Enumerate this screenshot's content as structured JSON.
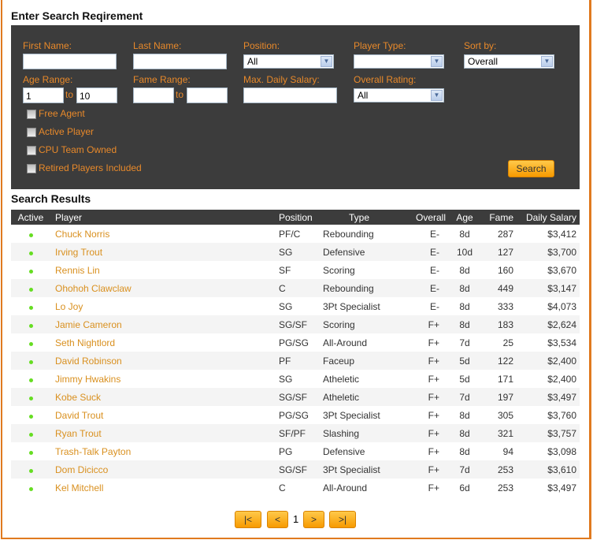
{
  "search": {
    "title": "Enter Search Reqirement",
    "first_name_label": "First Name:",
    "first_name": "",
    "last_name_label": "Last Name:",
    "last_name": "",
    "position_label": "Position:",
    "position": "All",
    "player_type_label": "Player Type:",
    "player_type": "",
    "sort_by_label": "Sort by:",
    "sort_by": "Overall",
    "age_range_label": "Age Range:",
    "age_min": "1",
    "age_max": "10",
    "to": "to",
    "fame_range_label": "Fame Range:",
    "fame_min": "",
    "fame_max": "",
    "max_salary_label": "Max. Daily Salary:",
    "max_salary": "",
    "overall_rating_label": "Overall Rating:",
    "overall_rating": "All",
    "checkboxes": [
      "Free Agent",
      "Active Player",
      "CPU Team Owned",
      "Retired Players Included"
    ],
    "search_button": "Search"
  },
  "results": {
    "title": "Search Results",
    "columns": [
      "Active",
      "Player",
      "Position",
      "Type",
      "Overall",
      "Age",
      "Fame",
      "Daily Salary"
    ],
    "rows": [
      [
        "Chuck Norris",
        "PF/C",
        "Rebounding",
        "E-",
        "8d",
        "287",
        "$3,412"
      ],
      [
        "Irving Trout",
        "SG",
        "Defensive",
        "E-",
        "10d",
        "127",
        "$3,700"
      ],
      [
        "Rennis Lin",
        "SF",
        "Scoring",
        "E-",
        "8d",
        "160",
        "$3,670"
      ],
      [
        "Ohohoh Clawclaw",
        "C",
        "Rebounding",
        "E-",
        "8d",
        "449",
        "$3,147"
      ],
      [
        "Lo Joy",
        "SG",
        "3Pt Specialist",
        "E-",
        "8d",
        "333",
        "$4,073"
      ],
      [
        "Jamie Cameron",
        "SG/SF",
        "Scoring",
        "F+",
        "8d",
        "183",
        "$2,624"
      ],
      [
        "Seth Nightlord",
        "PG/SG",
        "All-Around",
        "F+",
        "7d",
        "25",
        "$3,534"
      ],
      [
        "David Robinson",
        "PF",
        "Faceup",
        "F+",
        "5d",
        "122",
        "$2,400"
      ],
      [
        "Jimmy Hwakins",
        "SG",
        "Atheletic",
        "F+",
        "5d",
        "171",
        "$2,400"
      ],
      [
        "Kobe Suck",
        "SG/SF",
        "Atheletic",
        "F+",
        "7d",
        "197",
        "$3,497"
      ],
      [
        "David Trout",
        "PG/SG",
        "3Pt Specialist",
        "F+",
        "8d",
        "305",
        "$3,760"
      ],
      [
        "Ryan Trout",
        "SF/PF",
        "Slashing",
        "F+",
        "8d",
        "321",
        "$3,757"
      ],
      [
        "Trash-Talk Payton",
        "PG",
        "Defensive",
        "F+",
        "8d",
        "94",
        "$3,098"
      ],
      [
        "Dom Dicicco",
        "SG/SF",
        "3Pt Specialist",
        "F+",
        "7d",
        "253",
        "$3,610"
      ],
      [
        "Kel Mitchell",
        "C",
        "All-Around",
        "F+",
        "6d",
        "253",
        "$3,497"
      ]
    ]
  },
  "pagination": {
    "first": "|<",
    "prev": "<",
    "page": "1",
    "next": ">",
    "last": ">|"
  }
}
